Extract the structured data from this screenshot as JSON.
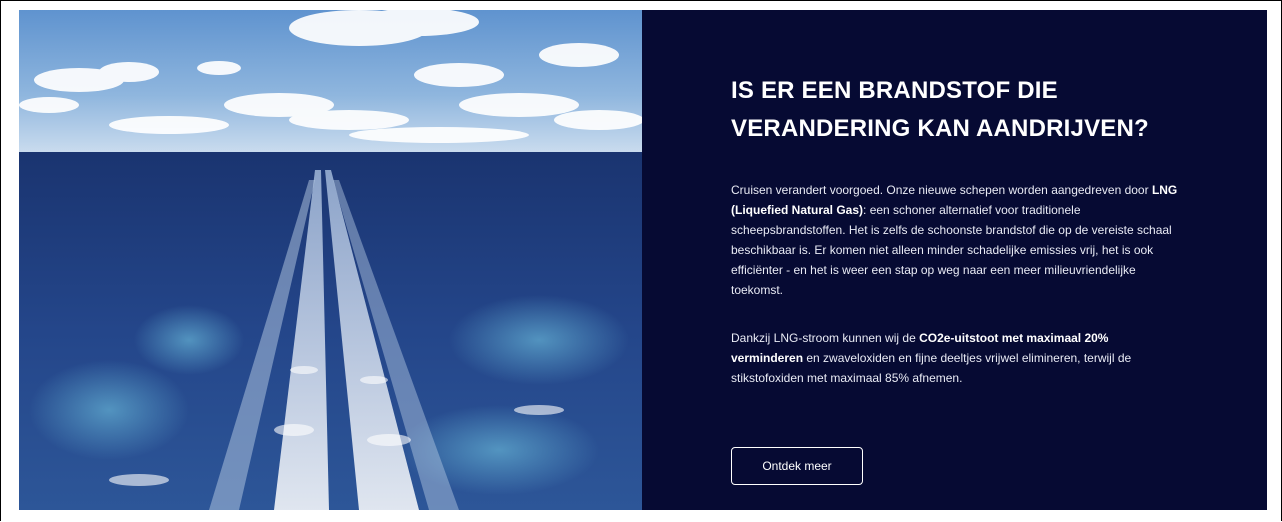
{
  "hero": {
    "image_alt": "Zee met kielzog van cruiseschip onder bewolkte lucht",
    "title": "IS ER EEN BRANDSTOF DIE VERANDERING KAN AANDRIJVEN?",
    "paragraph1": {
      "part1": "Cruisen verandert voorgoed. Onze nieuwe schepen worden aangedreven door ",
      "bold1": "LNG (Liquefied Natural Gas)",
      "part2": ": een schoner alternatief voor traditionele scheepsbrandstoffen. Het is zelfs de schoonste brandstof die op de vereiste schaal beschikbaar is. Er komen niet alleen minder schadelijke emissies vrij, het is ook efficiënter - en het is weer een stap op weg naar een meer milieuvriendelijke toekomst."
    },
    "paragraph2": {
      "part1": "Dankzij LNG-stroom kunnen wij de ",
      "bold1": "CO2e-uitstoot met maximaal 20% verminderen",
      "part2": " en zwaveloxiden en fijne deeltjes vrijwel elimineren, terwijl de stikstofoxiden met maximaal 85% afnemen."
    },
    "cta_label": "Ontdek meer"
  },
  "colors": {
    "panel_background": "#060a33",
    "text": "#ffffff"
  }
}
